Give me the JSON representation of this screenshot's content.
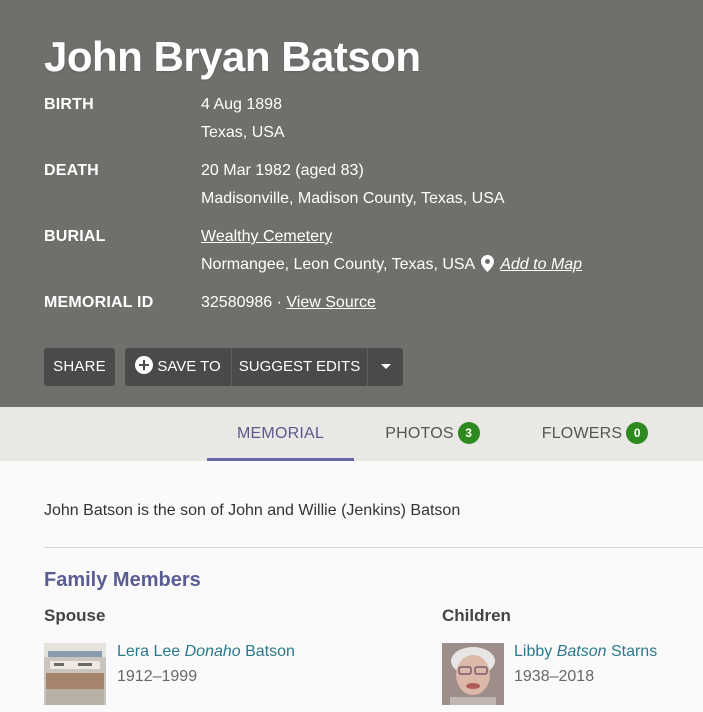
{
  "memorial": {
    "name": "John Bryan Batson",
    "birth": {
      "label": "BIRTH",
      "date": "4 Aug 1898",
      "place": "Texas, USA"
    },
    "death": {
      "label": "DEATH",
      "date": "20 Mar 1982 (aged 83)",
      "place": "Madisonville, Madison County, Texas, USA"
    },
    "burial": {
      "label": "BURIAL",
      "cemetery": "Wealthy Cemetery",
      "place": "Normangee, Leon County, Texas, USA",
      "add_to_map": "Add to Map"
    },
    "memorial_id": {
      "label": "MEMORIAL ID",
      "id": "32580986",
      "separator": " · ",
      "view_source": "View Source"
    }
  },
  "actions": {
    "share": "SHARE",
    "save_to": "SAVE TO",
    "suggest_edits": "SUGGEST EDITS"
  },
  "tabs": [
    {
      "label": "MEMORIAL",
      "active": true
    },
    {
      "label": "PHOTOS",
      "count": "3"
    },
    {
      "label": "FLOWERS",
      "count": "0"
    }
  ],
  "bio": "John Batson is the son of John and Willie (Jenkins) Batson",
  "family": {
    "title": "Family Members",
    "spouse": {
      "heading": "Spouse",
      "first": "Lera Lee ",
      "maiden": "Donaho",
      "last": " Batson",
      "dates": "1912–1999"
    },
    "children": {
      "heading": "Children",
      "first": "Libby ",
      "maiden": "Batson",
      "last": " Starns",
      "dates": "1938–2018"
    }
  },
  "colors": {
    "hero_bg": "#706f6c",
    "button_bg": "#4a4a4a",
    "tab_accent": "#6666a8",
    "badge_green": "#2e8a1f",
    "link_teal": "#2a7a8c",
    "section_title": "#5a5d94"
  },
  "icons": [
    "map-pin-icon",
    "plus-circle-icon",
    "caret-down-icon"
  ]
}
